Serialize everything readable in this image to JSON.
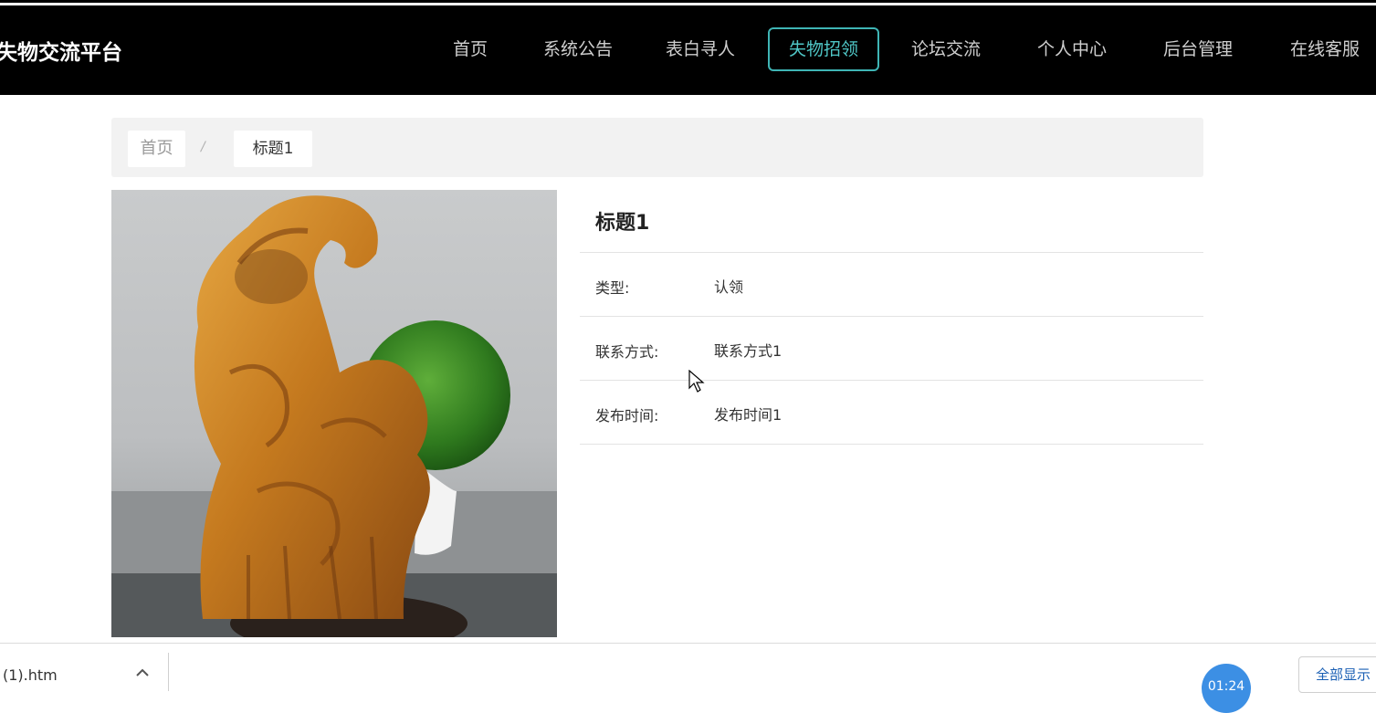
{
  "brand": "失物交流平台",
  "nav": {
    "items": [
      {
        "label": "首页"
      },
      {
        "label": "系统公告"
      },
      {
        "label": "表白寻人"
      },
      {
        "label": "失物招领"
      },
      {
        "label": "论坛交流"
      },
      {
        "label": "个人中心"
      },
      {
        "label": "后台管理"
      },
      {
        "label": "在线客服"
      }
    ],
    "active": "失物招领",
    "accent_color": "#3fb5b5"
  },
  "breadcrumb": {
    "home": "首页",
    "separator": "/",
    "current": "标题1"
  },
  "detail": {
    "title": "标题1",
    "rows": [
      {
        "label": "类型:",
        "value": "认领"
      },
      {
        "label": "联系方式:",
        "value": "联系方式1"
      },
      {
        "label": "发布时间:",
        "value": "发布时间1"
      }
    ]
  },
  "download_bar": {
    "file_name": "(1).htm",
    "show_all": "全部显示",
    "timer": "01:24"
  }
}
